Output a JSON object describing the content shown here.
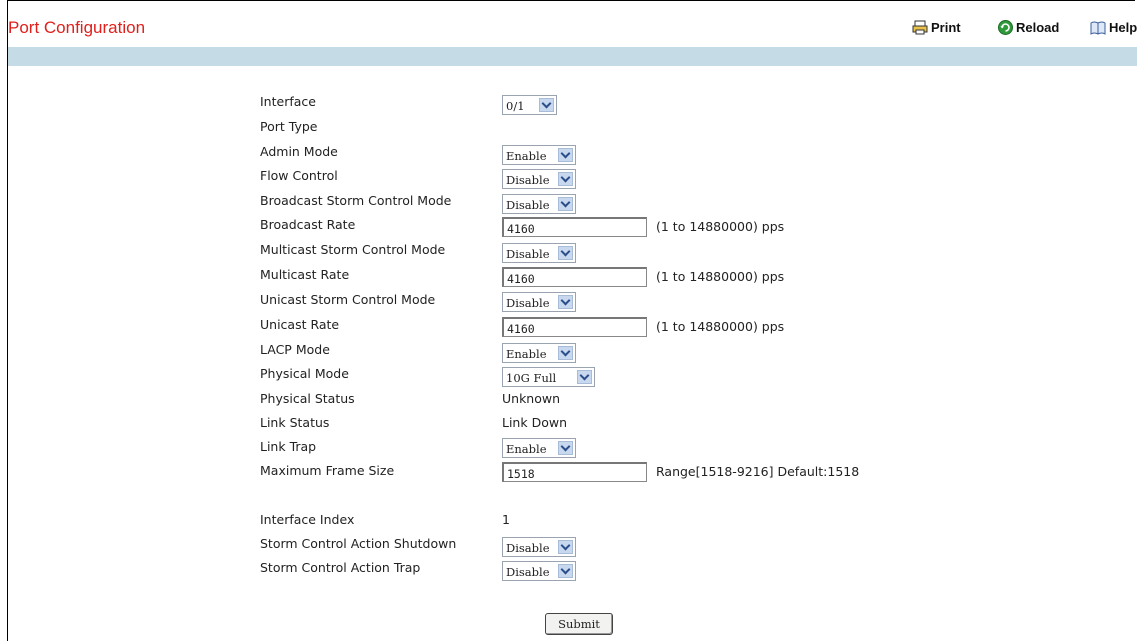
{
  "page": {
    "title": "Port Configuration"
  },
  "toolbar": {
    "print": "Print",
    "reload": "Reload",
    "help": "Help"
  },
  "form": {
    "interface": {
      "label": "Interface",
      "value": "0/1"
    },
    "port_type": {
      "label": "Port Type"
    },
    "admin_mode": {
      "label": "Admin Mode",
      "value": "Enable"
    },
    "flow_control": {
      "label": "Flow Control",
      "value": "Disable"
    },
    "bcast_mode": {
      "label": "Broadcast Storm Control Mode",
      "value": "Disable"
    },
    "bcast_rate": {
      "label": "Broadcast Rate",
      "value": "4160",
      "hint": "(1 to 14880000) pps"
    },
    "mcast_mode": {
      "label": "Multicast Storm Control Mode",
      "value": "Disable"
    },
    "mcast_rate": {
      "label": "Multicast Rate",
      "value": "4160",
      "hint": "(1 to 14880000) pps"
    },
    "ucast_mode": {
      "label": "Unicast Storm Control Mode",
      "value": "Disable"
    },
    "ucast_rate": {
      "label": "Unicast Rate",
      "value": "4160",
      "hint": "(1 to 14880000) pps"
    },
    "lacp_mode": {
      "label": "LACP Mode",
      "value": "Enable"
    },
    "physical_mode": {
      "label": "Physical Mode",
      "value": "10G Full"
    },
    "physical_status": {
      "label": "Physical Status",
      "value": "Unknown"
    },
    "link_status": {
      "label": "Link Status",
      "value": "Link Down"
    },
    "link_trap": {
      "label": "Link Trap",
      "value": "Enable"
    },
    "max_frame": {
      "label": "Maximum Frame Size",
      "value": "1518",
      "hint": "Range[1518-9216] Default:1518"
    },
    "if_index": {
      "label": "Interface Index",
      "value": "1"
    },
    "sc_shutdown": {
      "label": "Storm Control Action Shutdown",
      "value": "Disable"
    },
    "sc_trap": {
      "label": "Storm Control Action Trap",
      "value": "Disable"
    }
  },
  "submit": {
    "label": "Submit"
  },
  "colors": {
    "title": "#e0201c",
    "band": "#c5dbe6"
  }
}
